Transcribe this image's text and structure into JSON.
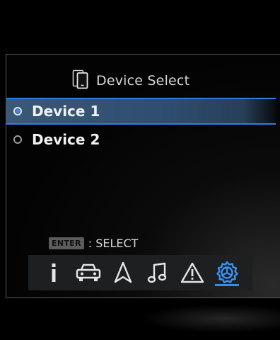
{
  "header": {
    "title": "Device Select",
    "icon": "phone-icon"
  },
  "devices": [
    {
      "label": "Device 1",
      "selected": true
    },
    {
      "label": "Device 2",
      "selected": false
    }
  ],
  "hint": {
    "key": "ENTER",
    "text": ": SELECT"
  },
  "iconbar": {
    "items": [
      "info-icon",
      "car-icon",
      "navigation-icon",
      "music-icon",
      "warning-icon",
      "settings-icon"
    ],
    "active": "settings-icon"
  },
  "colors": {
    "accent": "#2e8ff0",
    "selected_row": "#2f4d6e",
    "bar_bg": "#1e1f21"
  }
}
